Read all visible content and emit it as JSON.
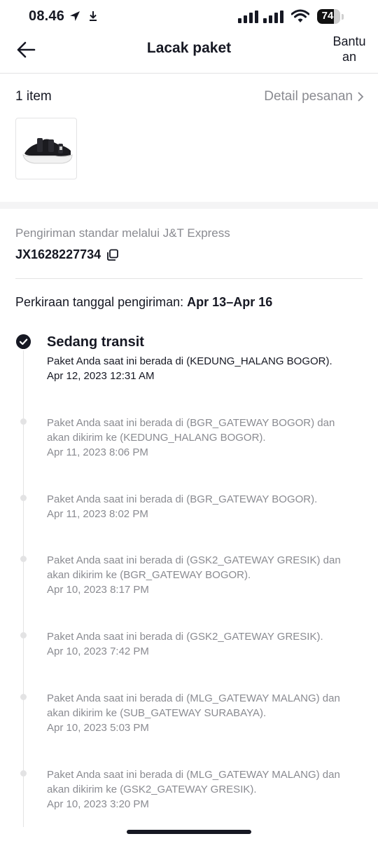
{
  "status_bar": {
    "time": "08.46",
    "battery": "74",
    "battery_level": 0.74
  },
  "header": {
    "title": "Lacak paket",
    "help_line1": "Bantu",
    "help_line2": "an"
  },
  "order": {
    "item_count": "1 item",
    "detail_link": "Detail pesanan",
    "thumbnail": "sandal-product-image"
  },
  "shipping": {
    "carrier": "Pengiriman standar melalui J&T Express",
    "tracking_number": "JX1628227734",
    "eta_label": "Perkiraan tanggal pengiriman:",
    "eta_value": "Apr 13–Apr 16"
  },
  "timeline": {
    "current": {
      "status": "Sedang transit",
      "description": "Paket Anda saat ini berada di (KEDUNG_HALANG BOGOR).",
      "time": "Apr 12, 2023 12:31 AM"
    },
    "events": [
      {
        "line1": "Paket Anda saat ini berada di (BGR_GATEWAY BOGOR) dan",
        "line2": "akan dikirim ke (KEDUNG_HALANG BOGOR).",
        "time": "Apr 11, 2023 8:06 PM"
      },
      {
        "line1": "Paket Anda saat ini berada di (BGR_GATEWAY BOGOR).",
        "line2": "",
        "time": "Apr 11, 2023 8:02 PM"
      },
      {
        "line1": "Paket Anda saat ini berada di (GSK2_GATEWAY GRESIK) dan",
        "line2": "akan dikirim ke (BGR_GATEWAY BOGOR).",
        "time": "Apr 10, 2023 8:17 PM"
      },
      {
        "line1": "Paket Anda saat ini berada di (GSK2_GATEWAY GRESIK).",
        "line2": "",
        "time": "Apr 10, 2023 7:42 PM"
      },
      {
        "line1": "Paket Anda saat ini berada di (MLG_GATEWAY MALANG) dan",
        "line2": "akan dikirim ke (SUB_GATEWAY SURABAYA).",
        "time": "Apr 10, 2023 5:03 PM"
      },
      {
        "line1": "Paket Anda saat ini berada di (MLG_GATEWAY MALANG) dan",
        "line2": "akan dikirim ke (GSK2_GATEWAY GRESIK).",
        "time": "Apr 10, 2023 3:20 PM"
      }
    ]
  }
}
